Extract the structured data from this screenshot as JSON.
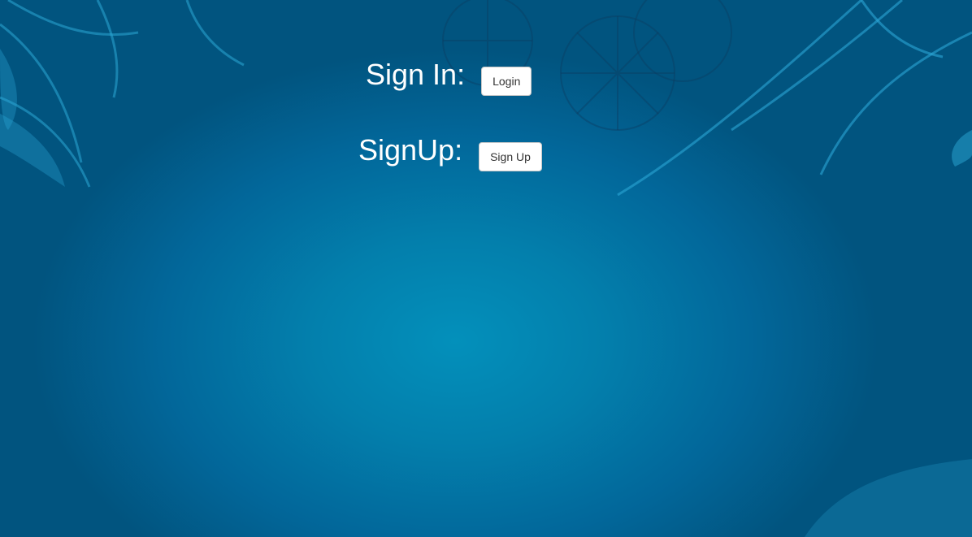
{
  "background": {
    "colors": {
      "center": "#0390bb",
      "edge": "#01547f",
      "swirl": "#2aa6d4"
    }
  },
  "signin": {
    "label": "Sign In: ",
    "button_label": "Login"
  },
  "signup": {
    "label": "SignUp: ",
    "button_label": "Sign Up"
  }
}
